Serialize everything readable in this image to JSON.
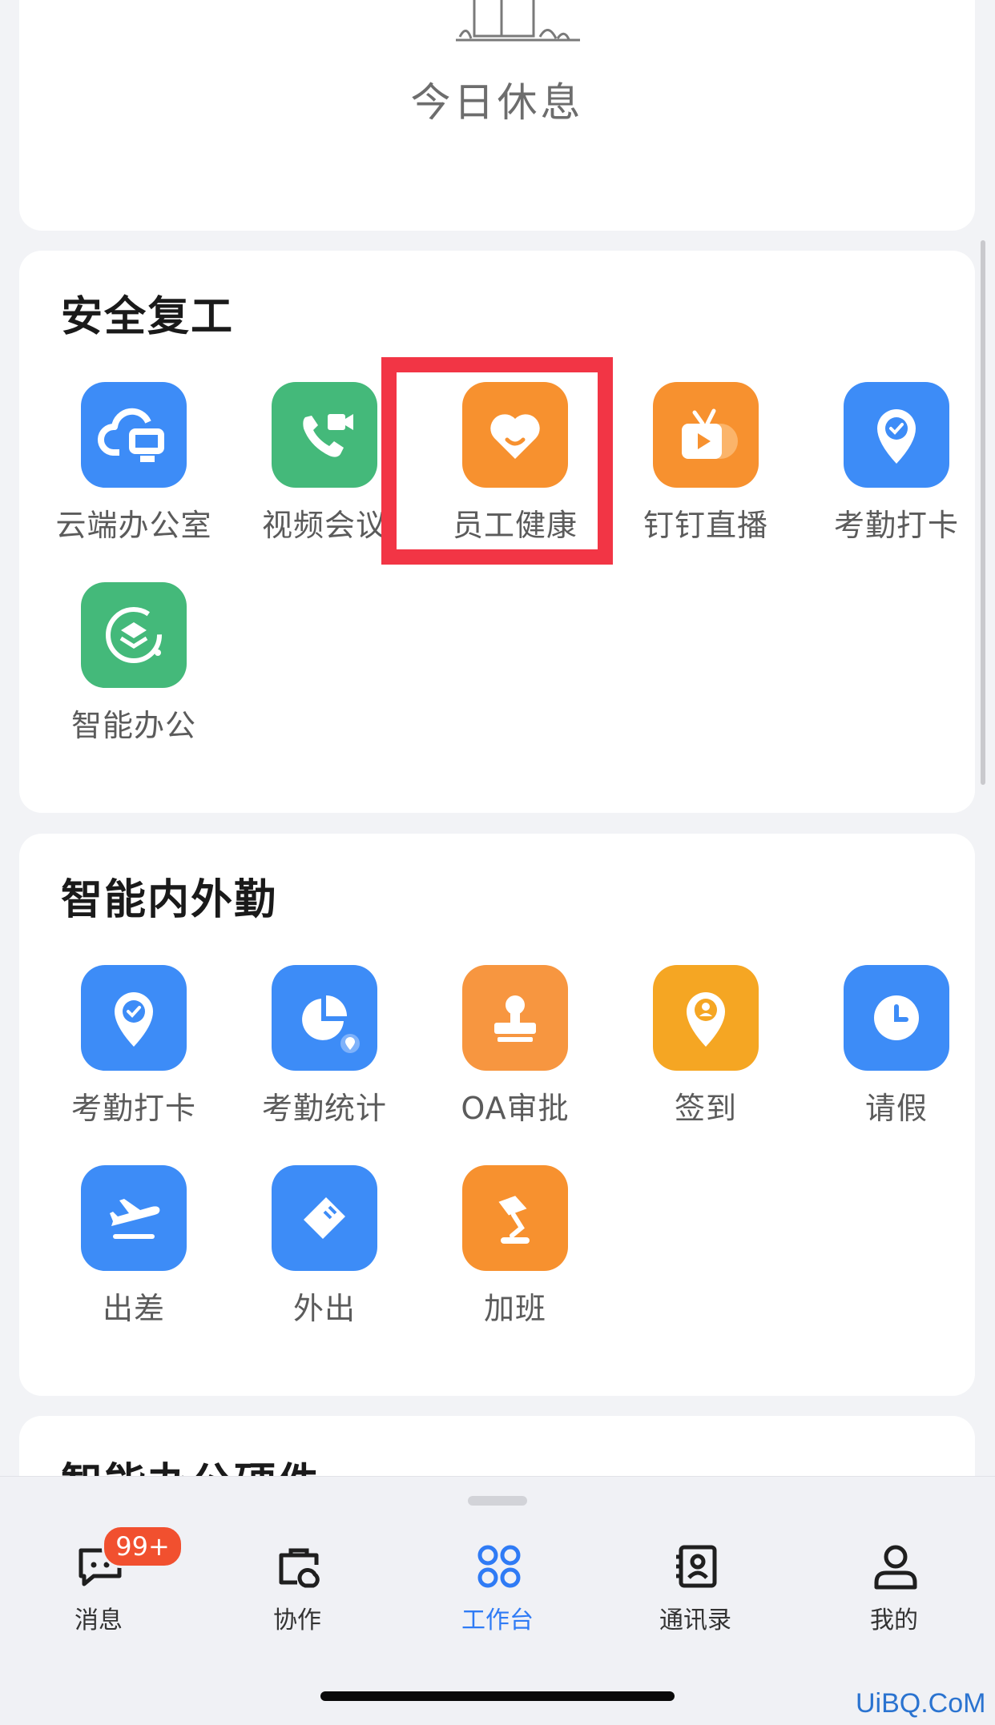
{
  "rest_card": {
    "status": "今日休息"
  },
  "safe_section": {
    "title": "安全复工",
    "apps": [
      {
        "label": "云端办公室",
        "icon": "cloud-computer-icon",
        "color": "#3d8cf7"
      },
      {
        "label": "视频会议",
        "icon": "video-call-icon",
        "color": "#44b97a"
      },
      {
        "label": "员工健康",
        "icon": "heart-smile-icon",
        "color": "#f7912f",
        "highlighted": true
      },
      {
        "label": "钉钉直播",
        "icon": "live-tv-icon",
        "color": "#f7912f"
      },
      {
        "label": "考勤打卡",
        "icon": "location-check-icon",
        "color": "#3d8cf7"
      },
      {
        "label": "智能办公",
        "icon": "smart-layers-icon",
        "color": "#44b97a"
      }
    ]
  },
  "field_section": {
    "title": "智能内外勤",
    "apps": [
      {
        "label": "考勤打卡",
        "icon": "location-check-icon",
        "color": "#3d8cf7"
      },
      {
        "label": "考勤统计",
        "icon": "pie-chart-icon",
        "color": "#3d8cf7"
      },
      {
        "label": "OA审批",
        "icon": "stamp-icon",
        "color": "#f79640"
      },
      {
        "label": "签到",
        "icon": "location-person-icon",
        "color": "#f5a623"
      },
      {
        "label": "请假",
        "icon": "clock-icon",
        "color": "#3d8cf7"
      },
      {
        "label": "出差",
        "icon": "airplane-icon",
        "color": "#3d8cf7"
      },
      {
        "label": "外出",
        "icon": "tag-icon",
        "color": "#3d8cf7"
      },
      {
        "label": "加班",
        "icon": "desk-lamp-icon",
        "color": "#f7912f"
      }
    ]
  },
  "hardware_section": {
    "title": "智能办公硬件"
  },
  "tabbar": {
    "tabs": [
      {
        "label": "消息",
        "icon": "message-icon",
        "badge": "99+"
      },
      {
        "label": "协作",
        "icon": "collaborate-icon"
      },
      {
        "label": "工作台",
        "icon": "workbench-icon",
        "active": true
      },
      {
        "label": "通讯录",
        "icon": "contacts-icon"
      },
      {
        "label": "我的",
        "icon": "profile-icon"
      }
    ],
    "active_color": "#2f7bf5"
  },
  "watermark": "UiBQ.CoM"
}
